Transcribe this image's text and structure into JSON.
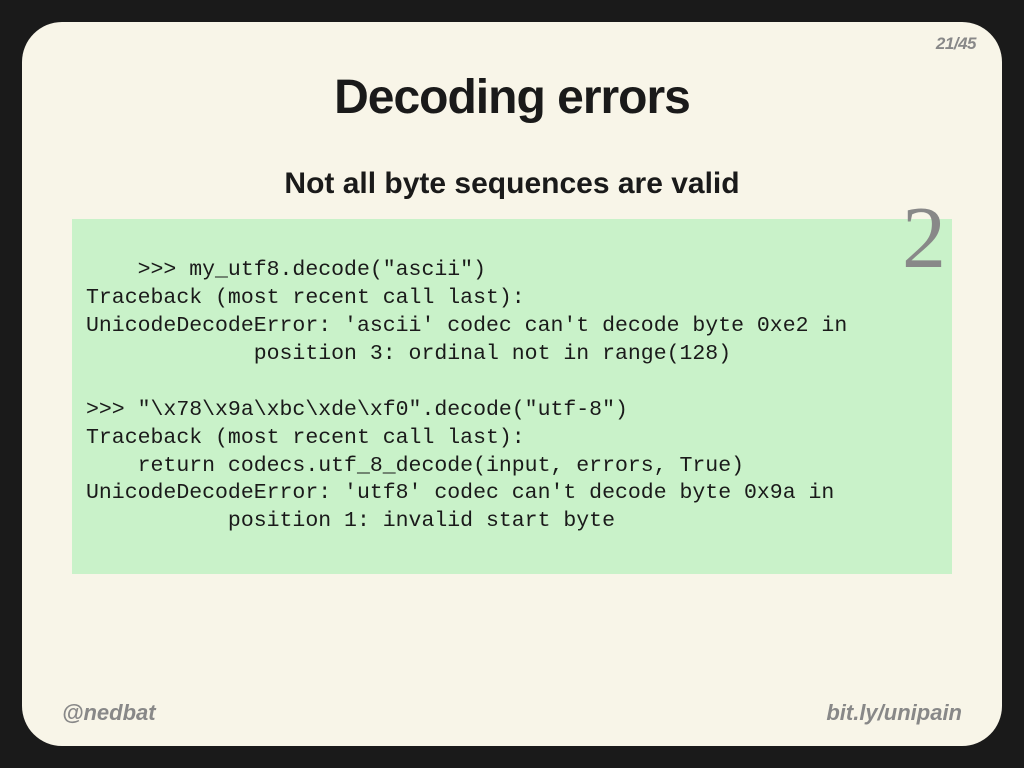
{
  "page": {
    "current": "21",
    "total": "45"
  },
  "title": "Decoding errors",
  "subtitle": "Not all byte sequences are valid",
  "code": ">>> my_utf8.decode(\"ascii\")\nTraceback (most recent call last):\nUnicodeDecodeError: 'ascii' codec can't decode byte 0xe2 in\n             position 3: ordinal not in range(128)\n\n>>> \"\\x78\\x9a\\xbc\\xde\\xf0\".decode(\"utf-8\")\nTraceback (most recent call last):\n    return codecs.utf_8_decode(input, errors, True)\nUnicodeDecodeError: 'utf8' codec can't decode byte 0x9a in\n           position 1: invalid start byte",
  "annotation": "2",
  "footer": {
    "left": "@nedbat",
    "right": "bit.ly/unipain"
  }
}
